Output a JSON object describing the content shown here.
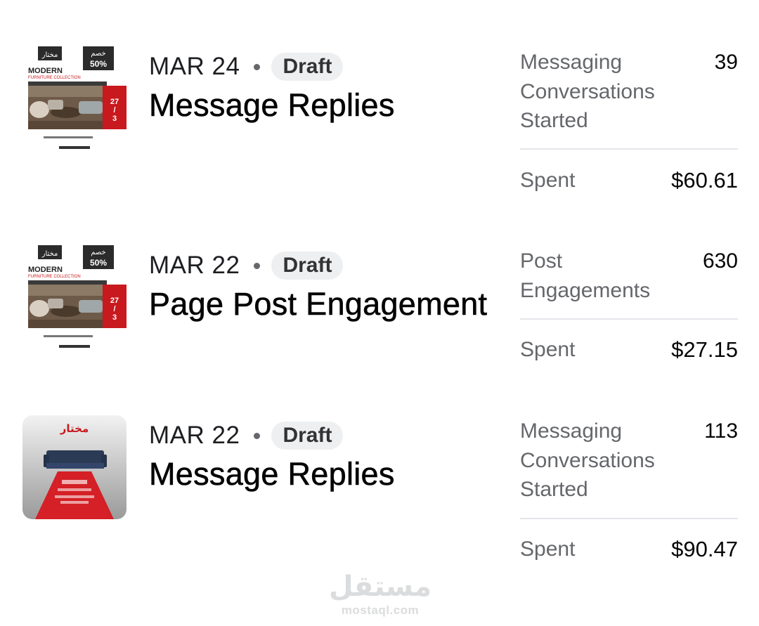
{
  "campaigns": [
    {
      "date": "MAR 24",
      "status": "Draft",
      "objective": "Message Replies",
      "metric_label": "Messaging Conversations Started",
      "metric_value": "39",
      "spent_label": "Spent",
      "spent_value": "$60.61",
      "thumbnail": {
        "type": "ad-creative-modern",
        "brand_mark": "مختار",
        "discount_line": "خصم",
        "discount_pct": "50%",
        "headline": "MODERN",
        "subheadline": "FURNITURE COLLECTION",
        "date_badge": "27 / 3"
      }
    },
    {
      "date": "MAR 22",
      "status": "Draft",
      "objective": "Page Post Engagement",
      "metric_label": "Post Engagements",
      "metric_value": "630",
      "spent_label": "Spent",
      "spent_value": "$27.15",
      "thumbnail": {
        "type": "ad-creative-modern",
        "brand_mark": "مختار",
        "discount_line": "خصم",
        "discount_pct": "50%",
        "headline": "MODERN",
        "subheadline": "FURNITURE COLLECTION",
        "date_badge": "27 / 3"
      }
    },
    {
      "date": "MAR 22",
      "status": "Draft",
      "objective": "Message Replies",
      "metric_label": "Messaging Conversations Started",
      "metric_value": "113",
      "spent_label": "Spent",
      "spent_value": "$90.47",
      "thumbnail": {
        "type": "ad-creative-sofa",
        "brand_mark": "مختار"
      }
    }
  ],
  "watermark": {
    "logo": "مستقل",
    "domain": "mostaql.com"
  },
  "colors": {
    "accent_red": "#c8191e",
    "badge_bg": "#eeeff1",
    "secondary_text": "#65676b",
    "divider": "#e4e6eb"
  }
}
